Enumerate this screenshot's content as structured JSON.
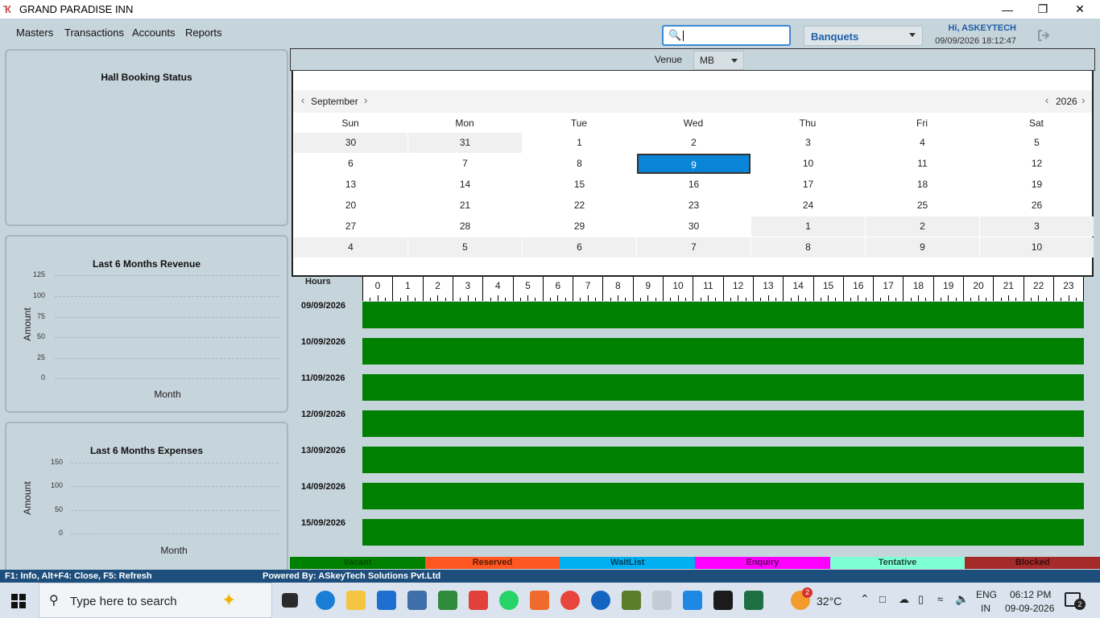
{
  "window": {
    "title": "GRAND PARADISE INN",
    "minimize": "—",
    "maximize": "❐",
    "close": "✕"
  },
  "menu": [
    "Masters",
    "Transactions",
    "Accounts",
    "Reports"
  ],
  "search": {
    "placeholder": ""
  },
  "module_select": {
    "value": "Banquets"
  },
  "user": {
    "greeting": "Hi, ASKEYTECH",
    "datetime": "09/09/2026 18:12:47"
  },
  "panels": {
    "hall_booking": {
      "title": "Hall Booking Status"
    },
    "revenue": {
      "title": "Last 6 Months Revenue",
      "ylabel": "Amount",
      "xlabel": "Month",
      "ticks": [
        "125",
        "100",
        "75",
        "50",
        "25",
        "0"
      ]
    },
    "expenses": {
      "title": "Last 6 Months Expenses",
      "ylabel": "Amount",
      "xlabel": "Month",
      "ticks": [
        "150",
        "100",
        "50",
        "0"
      ]
    }
  },
  "venue": {
    "label": "Venue",
    "value": "MB"
  },
  "calendar": {
    "month": "September",
    "year": "2026",
    "prev_month": "‹",
    "next_month": "›",
    "prev_year": "‹",
    "next_year": "›",
    "weekdays": [
      "Sun",
      "Mon",
      "Tue",
      "Wed",
      "Thu",
      "Fri",
      "Sat"
    ],
    "weeks": [
      [
        "30",
        "31",
        "1",
        "2",
        "3",
        "4",
        "5"
      ],
      [
        "6",
        "7",
        "8",
        "9",
        "10",
        "11",
        "12"
      ],
      [
        "13",
        "14",
        "15",
        "16",
        "17",
        "18",
        "19"
      ],
      [
        "20",
        "21",
        "22",
        "23",
        "24",
        "25",
        "26"
      ],
      [
        "27",
        "28",
        "29",
        "30",
        "1",
        "2",
        "3"
      ],
      [
        "4",
        "5",
        "6",
        "7",
        "8",
        "9",
        "10"
      ]
    ],
    "selected": "9"
  },
  "timeline": {
    "hours_label": "Hours",
    "hours": [
      "0",
      "1",
      "2",
      "3",
      "4",
      "5",
      "6",
      "7",
      "8",
      "9",
      "10",
      "11",
      "12",
      "13",
      "14",
      "15",
      "16",
      "17",
      "18",
      "19",
      "20",
      "21",
      "22",
      "23"
    ],
    "rows": [
      {
        "date": "09/09/2026",
        "status": "Vacant"
      },
      {
        "date": "10/09/2026",
        "status": "Vacant"
      },
      {
        "date": "11/09/2026",
        "status": "Vacant"
      },
      {
        "date": "12/09/2026",
        "status": "Vacant"
      },
      {
        "date": "13/09/2026",
        "status": "Vacant"
      },
      {
        "date": "14/09/2026",
        "status": "Vacant"
      },
      {
        "date": "15/09/2026",
        "status": "Vacant"
      }
    ]
  },
  "legend": [
    {
      "label": "Vacant",
      "bg": "#008000",
      "fg": "#004d00"
    },
    {
      "label": "Reserved",
      "bg": "#ff5722",
      "fg": "#5a1a00"
    },
    {
      "label": "WaitList",
      "bg": "#00b0f0",
      "fg": "#003b56"
    },
    {
      "label": "Enquiry",
      "bg": "#ff00ff",
      "fg": "#5a005a"
    },
    {
      "label": "Tentative",
      "bg": "#7fffd4",
      "fg": "#1d4a3c"
    },
    {
      "label": "Blocked",
      "bg": "#a52a2a",
      "fg": "#3d0a0a"
    }
  ],
  "statusbar": {
    "shortcuts": "F1: Info, Alt+F4: Close, F5: Refresh",
    "powered_by": "Powered By: ASkeyTech Solutions Pvt.Ltd"
  },
  "taskbar": {
    "search_placeholder": "Type here to search",
    "weather": "32°C",
    "weather_badge": "2",
    "language": "ENG",
    "region": "IN",
    "time": "06:12 PM",
    "date": "09-09-2026",
    "notifications": "2"
  }
}
